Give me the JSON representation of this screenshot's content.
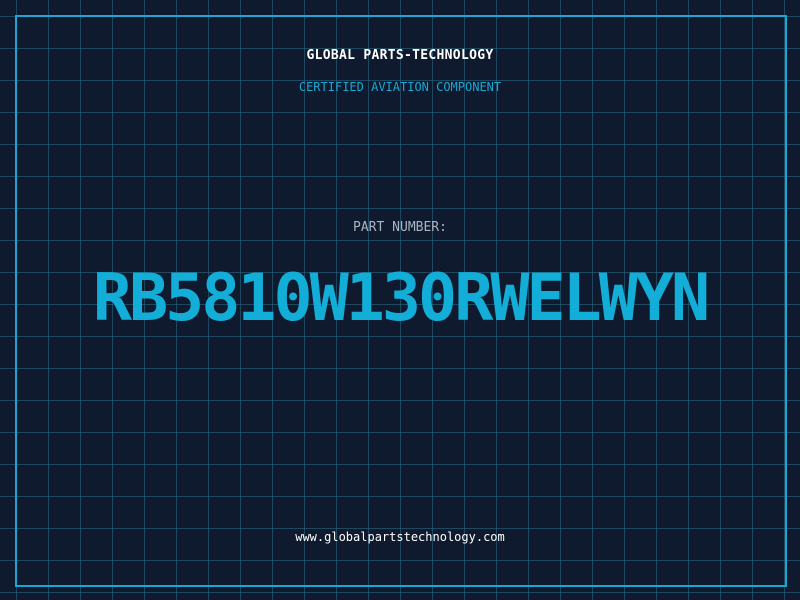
{
  "header": {
    "company": "GLOBAL PARTS-TECHNOLOGY",
    "subtitle": "CERTIFIED AVIATION COMPONENT"
  },
  "part": {
    "label": "PART NUMBER:",
    "number": "RB5810W130RWELWYN"
  },
  "footer": {
    "website": "www.globalpartstechnology.com"
  },
  "colors": {
    "background": "#0f1a2e",
    "accent": "#1aa7d4",
    "grid": "#2b6e87"
  }
}
